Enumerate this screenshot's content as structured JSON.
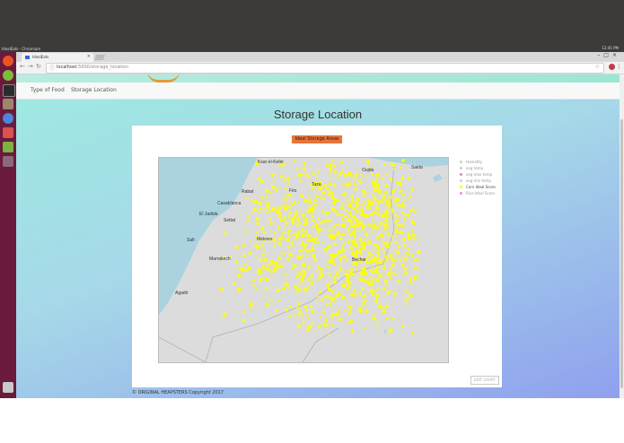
{
  "system": {
    "window_title": "IdealEats - Chromium",
    "clock": "12:45 PM"
  },
  "browser": {
    "tab_title": "IdealEats",
    "url_host": "localhost",
    "url_path": ":5000/storage_location"
  },
  "site": {
    "nav": [
      "Type of Food",
      "Storage Location"
    ]
  },
  "page": {
    "title": "Storage Location",
    "ideal_button": "Ideal Storage Areas",
    "edit_chart": "EDIT CHART",
    "footer": "© ORIGINAL HEAPSTERS Copyright 2017"
  },
  "map": {
    "labels": [
      "Ksar el-Kebir",
      "Oujda",
      "Saida",
      "Taza",
      "Fès",
      "Rabat",
      "Casablanca",
      "El Jadida",
      "Settat",
      "Safi",
      "Meknes",
      "Marrakech",
      "Bechar",
      "Agadir"
    ],
    "points_color": "#ffff00",
    "sea_color": "#aad3df",
    "land_color": "#dcdcdc"
  },
  "legend": [
    {
      "label": "Humidity",
      "color": "#cfcfcf",
      "active": false
    },
    {
      "label": "avg temp",
      "color": "#cfcfcf",
      "active": false
    },
    {
      "label": "avg max temp",
      "color": "#d48ad4",
      "active": false
    },
    {
      "label": "avg min temp",
      "color": "#cfcfcf",
      "active": false
    },
    {
      "label": "Corn Ideal Score",
      "color": "#ffff00",
      "active": true
    },
    {
      "label": "Rice Ideal Score",
      "color": "#e98be9",
      "active": false
    }
  ]
}
